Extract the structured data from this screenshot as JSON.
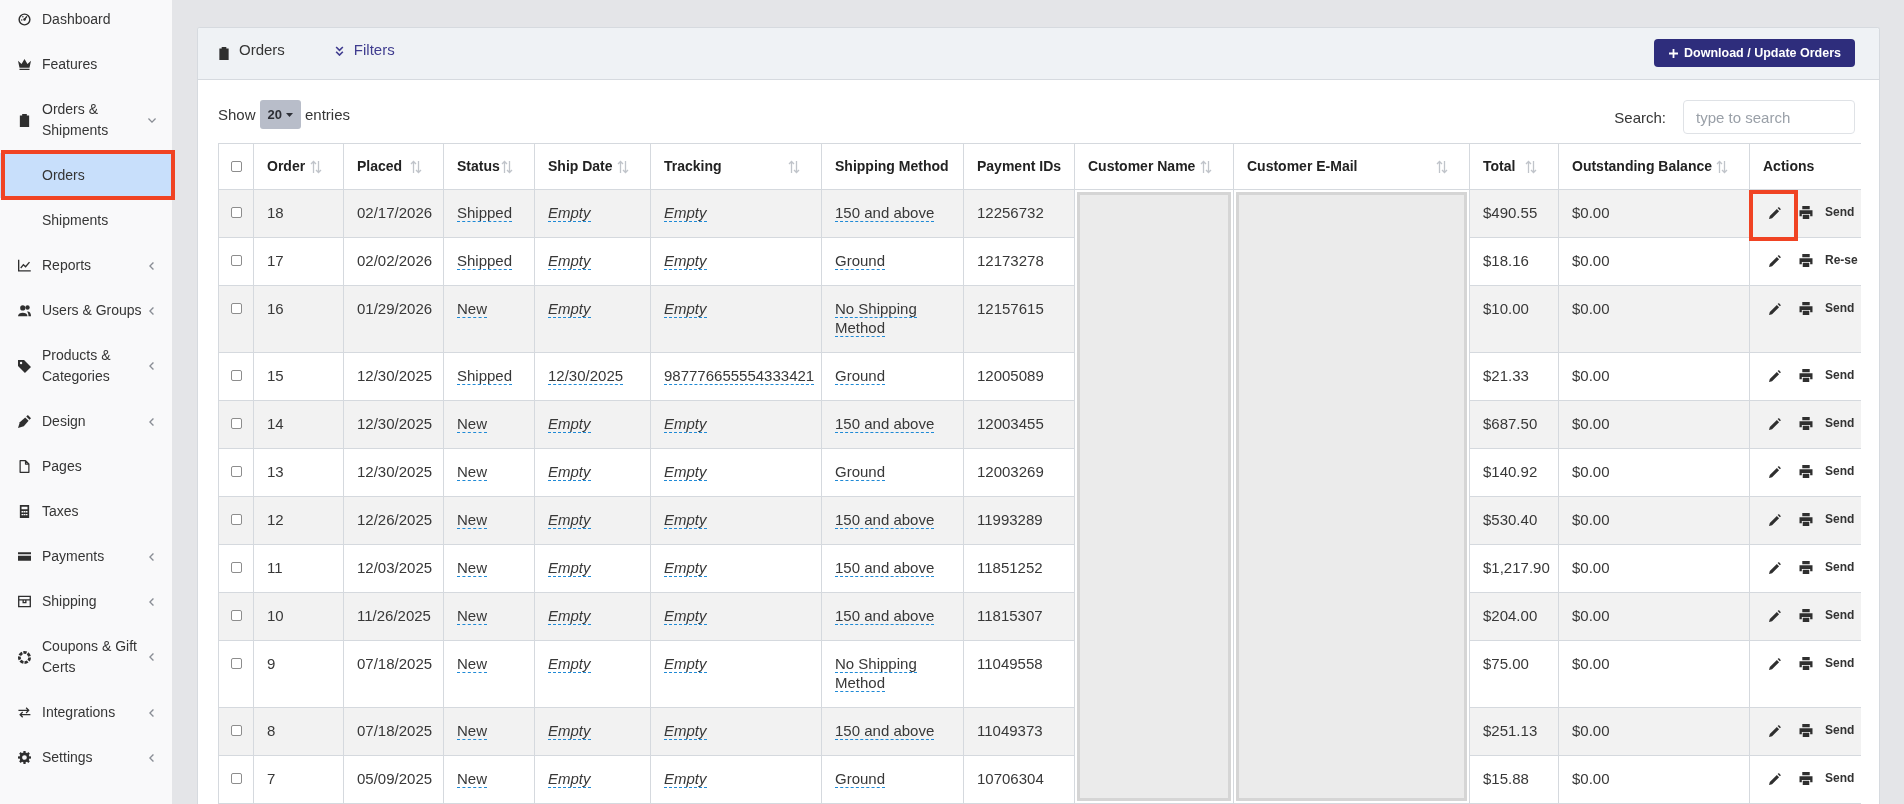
{
  "sidebar": {
    "items": [
      {
        "label": "Dashboard",
        "kind": "link",
        "selected": false,
        "highlighted": false
      },
      {
        "label": "Features",
        "kind": "link",
        "selected": false,
        "highlighted": false
      },
      {
        "label": "Orders & Shipments",
        "kind": "group",
        "expanded": true,
        "selected": false,
        "highlighted": false,
        "children": [
          {
            "label": "Orders",
            "selected": true,
            "highlighted": true
          },
          {
            "label": "Shipments",
            "selected": false,
            "highlighted": false
          }
        ]
      },
      {
        "label": "Reports",
        "kind": "group",
        "expanded": false,
        "selected": false,
        "highlighted": false
      },
      {
        "label": "Users & Groups",
        "kind": "group",
        "expanded": false,
        "selected": false,
        "highlighted": false
      },
      {
        "label": "Products & Categories",
        "kind": "group",
        "expanded": false,
        "selected": false,
        "highlighted": false
      },
      {
        "label": "Design",
        "kind": "group",
        "expanded": false,
        "selected": false,
        "highlighted": false
      },
      {
        "label": "Pages",
        "kind": "link",
        "selected": false,
        "highlighted": false
      },
      {
        "label": "Taxes",
        "kind": "link",
        "selected": false,
        "highlighted": false
      },
      {
        "label": "Payments",
        "kind": "group",
        "expanded": false,
        "selected": false,
        "highlighted": false
      },
      {
        "label": "Shipping",
        "kind": "group",
        "expanded": false,
        "selected": false,
        "highlighted": false
      },
      {
        "label": "Coupons & Gift Certs",
        "kind": "group",
        "expanded": false,
        "selected": false,
        "highlighted": false
      },
      {
        "label": "Integrations",
        "kind": "group",
        "expanded": false,
        "selected": false,
        "highlighted": false
      },
      {
        "label": "Settings",
        "kind": "group",
        "expanded": false,
        "selected": false,
        "highlighted": false
      }
    ]
  },
  "card": {
    "title": "Orders",
    "filters_label": "Filters",
    "download_button": "Download / Update Orders"
  },
  "length_control": {
    "label_before": "Show",
    "value": "20",
    "label_after": "entries"
  },
  "search": {
    "label": "Search:",
    "placeholder": "type to search"
  },
  "table": {
    "header_checkbox": {
      "checked": false
    },
    "columns": [
      {
        "label": "Order",
        "kind": "text",
        "sortable": true
      },
      {
        "label": "Placed",
        "kind": "text",
        "sortable": true
      },
      {
        "label": "Status",
        "kind": "editable",
        "sortable": true
      },
      {
        "label": "Ship Date",
        "kind": "editable",
        "sortable": true
      },
      {
        "label": "Tracking",
        "kind": "editable",
        "sortable": true
      },
      {
        "label": "Shipping Method",
        "kind": "editable",
        "sortable": false
      },
      {
        "label": "Payment IDs",
        "kind": "text",
        "sortable": false
      },
      {
        "label": "Customer Name",
        "kind": "redacted",
        "sortable": true
      },
      {
        "label": "Customer E-Mail",
        "kind": "redacted",
        "sortable": true
      },
      {
        "label": "Total",
        "kind": "text",
        "sortable": true
      },
      {
        "label": "Outstanding Balance",
        "kind": "text",
        "sortable": true
      },
      {
        "label": "Actions",
        "kind": "actions",
        "sortable": false
      }
    ],
    "rows": [
      {
        "checked": false,
        "cells": [
          "18",
          "02/17/2026",
          {
            "text": "Shipped",
            "empty": false
          },
          {
            "text": "Empty",
            "empty": true
          },
          {
            "text": "Empty",
            "empty": true
          },
          {
            "text": "150 and above",
            "empty": false
          },
          "12256732",
          "$490.55",
          "$0.00"
        ],
        "action": "Send",
        "edit_highlighted": true
      },
      {
        "checked": false,
        "cells": [
          "17",
          "02/02/2026",
          {
            "text": "Shipped",
            "empty": false
          },
          {
            "text": "Empty",
            "empty": true
          },
          {
            "text": "Empty",
            "empty": true
          },
          {
            "text": "Ground",
            "empty": false
          },
          "12173278",
          "$18.16",
          "$0.00"
        ],
        "action": "Re-se",
        "edit_highlighted": false
      },
      {
        "checked": false,
        "cells": [
          "16",
          "01/29/2026",
          {
            "text": "New",
            "empty": false
          },
          {
            "text": "Empty",
            "empty": true
          },
          {
            "text": "Empty",
            "empty": true
          },
          {
            "text": "No Shipping Method",
            "empty": false
          },
          "12157615",
          "$10.00",
          "$0.00"
        ],
        "action": "Send",
        "edit_highlighted": false
      },
      {
        "checked": false,
        "cells": [
          "15",
          "12/30/2025",
          {
            "text": "Shipped",
            "empty": false
          },
          {
            "text": "12/30/2025",
            "empty": false
          },
          {
            "text": "987776655554333421",
            "empty": false
          },
          {
            "text": "Ground",
            "empty": false
          },
          "12005089",
          "$21.33",
          "$0.00"
        ],
        "action": "Send",
        "edit_highlighted": false
      },
      {
        "checked": false,
        "cells": [
          "14",
          "12/30/2025",
          {
            "text": "New",
            "empty": false
          },
          {
            "text": "Empty",
            "empty": true
          },
          {
            "text": "Empty",
            "empty": true
          },
          {
            "text": "150 and above",
            "empty": false
          },
          "12003455",
          "$687.50",
          "$0.00"
        ],
        "action": "Send",
        "edit_highlighted": false
      },
      {
        "checked": false,
        "cells": [
          "13",
          "12/30/2025",
          {
            "text": "New",
            "empty": false
          },
          {
            "text": "Empty",
            "empty": true
          },
          {
            "text": "Empty",
            "empty": true
          },
          {
            "text": "Ground",
            "empty": false
          },
          "12003269",
          "$140.92",
          "$0.00"
        ],
        "action": "Send",
        "edit_highlighted": false
      },
      {
        "checked": false,
        "cells": [
          "12",
          "12/26/2025",
          {
            "text": "New",
            "empty": false
          },
          {
            "text": "Empty",
            "empty": true
          },
          {
            "text": "Empty",
            "empty": true
          },
          {
            "text": "150 and above",
            "empty": false
          },
          "11993289",
          "$530.40",
          "$0.00"
        ],
        "action": "Send",
        "edit_highlighted": false
      },
      {
        "checked": false,
        "cells": [
          "11",
          "12/03/2025",
          {
            "text": "New",
            "empty": false
          },
          {
            "text": "Empty",
            "empty": true
          },
          {
            "text": "Empty",
            "empty": true
          },
          {
            "text": "150 and above",
            "empty": false
          },
          "11851252",
          "$1,217.90",
          "$0.00"
        ],
        "action": "Send",
        "edit_highlighted": false
      },
      {
        "checked": false,
        "cells": [
          "10",
          "11/26/2025",
          {
            "text": "New",
            "empty": false
          },
          {
            "text": "Empty",
            "empty": true
          },
          {
            "text": "Empty",
            "empty": true
          },
          {
            "text": "150 and above",
            "empty": false
          },
          "11815307",
          "$204.00",
          "$0.00"
        ],
        "action": "Send",
        "edit_highlighted": false
      },
      {
        "checked": false,
        "cells": [
          "9",
          "07/18/2025",
          {
            "text": "New",
            "empty": false
          },
          {
            "text": "Empty",
            "empty": true
          },
          {
            "text": "Empty",
            "empty": true
          },
          {
            "text": "No Shipping Method",
            "empty": false
          },
          "11049558",
          "$75.00",
          "$0.00"
        ],
        "action": "Send",
        "edit_highlighted": false
      },
      {
        "checked": false,
        "cells": [
          "8",
          "07/18/2025",
          {
            "text": "New",
            "empty": false
          },
          {
            "text": "Empty",
            "empty": true
          },
          {
            "text": "Empty",
            "empty": true
          },
          {
            "text": "150 and above",
            "empty": false
          },
          "11049373",
          "$251.13",
          "$0.00"
        ],
        "action": "Send",
        "edit_highlighted": false
      },
      {
        "checked": false,
        "cells": [
          "7",
          "05/09/2025",
          {
            "text": "New",
            "empty": false
          },
          {
            "text": "Empty",
            "empty": true
          },
          {
            "text": "Empty",
            "empty": true
          },
          {
            "text": "Ground",
            "empty": false
          },
          "10706304",
          "$15.88",
          "$0.00"
        ],
        "action": "Send",
        "edit_highlighted": false
      }
    ]
  }
}
